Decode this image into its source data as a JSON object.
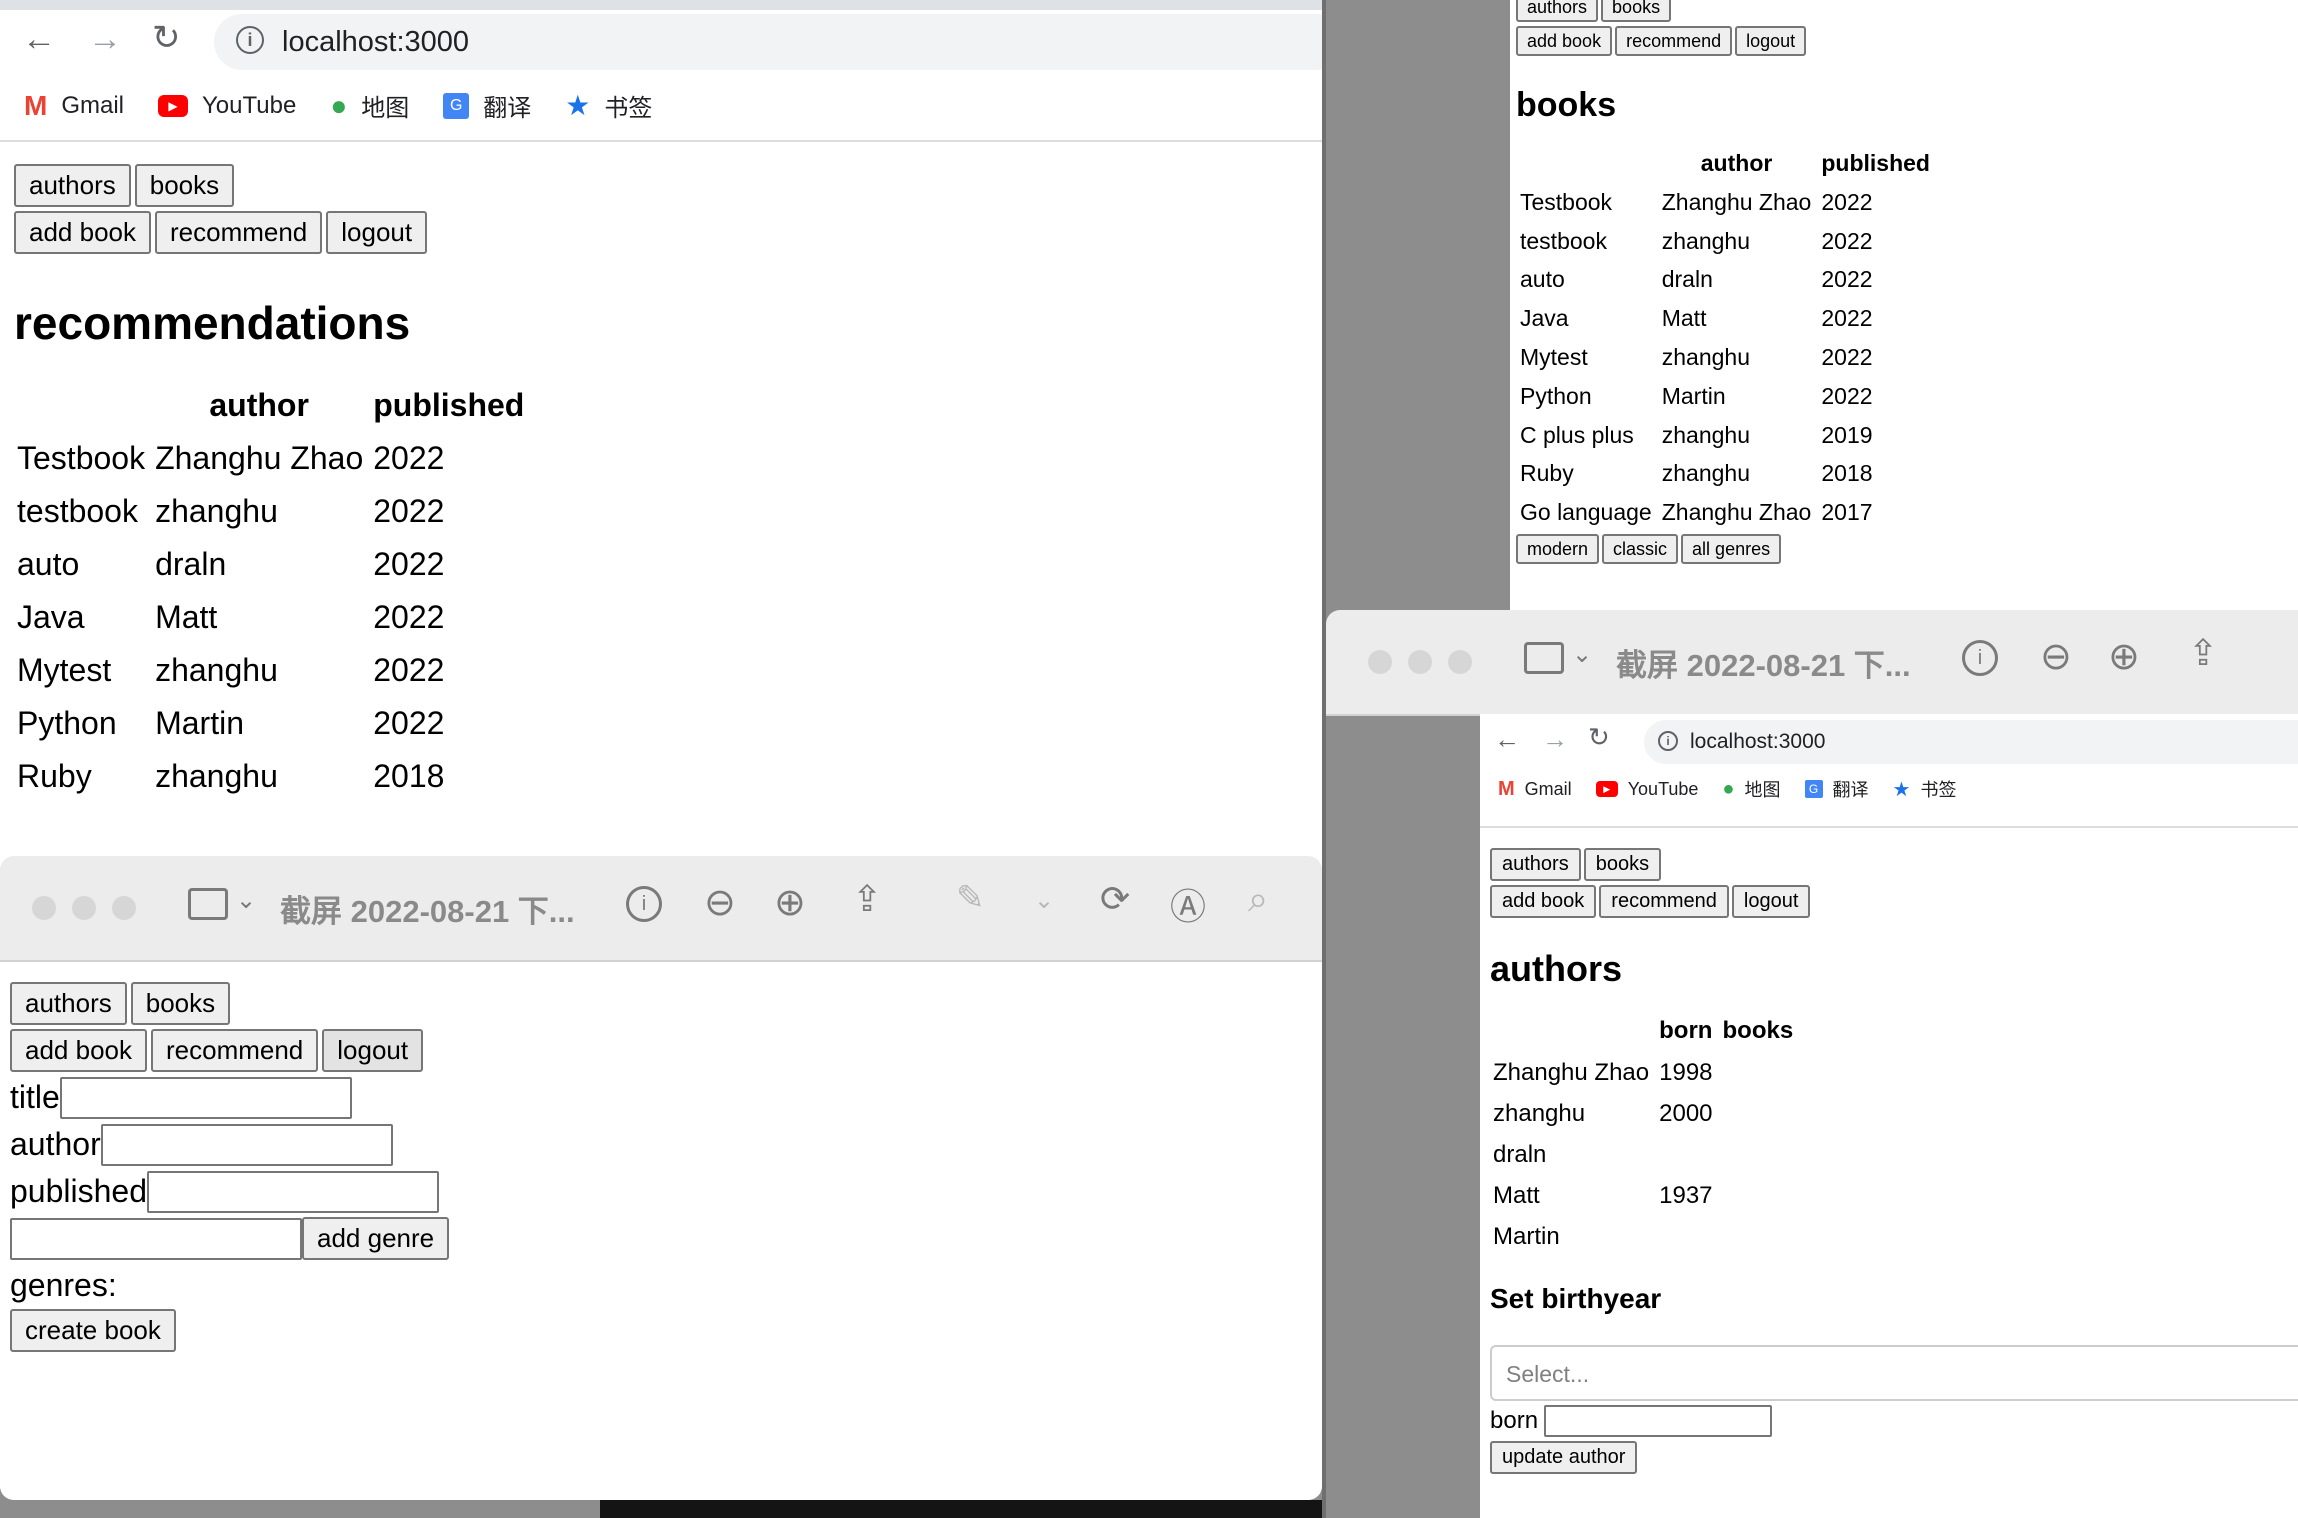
{
  "browser": {
    "url": "localhost:3000",
    "bookmarks": [
      {
        "label": "Gmail",
        "icon": "gmail-icon"
      },
      {
        "label": "YouTube",
        "icon": "youtube-icon"
      },
      {
        "label": "地图",
        "icon": "maps-icon"
      },
      {
        "label": "翻译",
        "icon": "translate-icon"
      },
      {
        "label": "书签",
        "icon": "bookmark-star-icon"
      }
    ]
  },
  "nav": {
    "authors": "authors",
    "books": "books",
    "add_book": "add book",
    "recommend": "recommend",
    "logout": "logout"
  },
  "recommendations": {
    "heading": "recommendations",
    "columns": [
      "",
      "author",
      "published"
    ],
    "rows": [
      [
        "Testbook",
        "Zhanghu Zhao",
        "2022"
      ],
      [
        "testbook",
        "zhanghu",
        "2022"
      ],
      [
        "auto",
        "draln",
        "2022"
      ],
      [
        "Java",
        "Matt",
        "2022"
      ],
      [
        "Mytest",
        "zhanghu",
        "2022"
      ],
      [
        "Python",
        "Martin",
        "2022"
      ],
      [
        "Ruby",
        "zhanghu",
        "2018"
      ]
    ]
  },
  "viewer": {
    "title": "截屏 2022-08-21 下..."
  },
  "add_book_form": {
    "title_label": "title",
    "author_label": "author",
    "published_label": "published",
    "add_genre_button": "add genre",
    "genres_label": "genres:",
    "create_button": "create book"
  },
  "books_page": {
    "heading": "books",
    "columns": [
      "",
      "author",
      "published"
    ],
    "rows": [
      [
        "Testbook",
        "Zhanghu Zhao",
        "2022"
      ],
      [
        "testbook",
        "zhanghu",
        "2022"
      ],
      [
        "auto",
        "draln",
        "2022"
      ],
      [
        "Java",
        "Matt",
        "2022"
      ],
      [
        "Mytest",
        "zhanghu",
        "2022"
      ],
      [
        "Python",
        "Martin",
        "2022"
      ],
      [
        "C plus plus",
        "zhanghu",
        "2019"
      ],
      [
        "Ruby",
        "zhanghu",
        "2018"
      ],
      [
        "Go language",
        "Zhanghu Zhao",
        "2017"
      ]
    ],
    "genre_buttons": [
      "modern",
      "classic",
      "all genres"
    ]
  },
  "authors_page": {
    "heading": "authors",
    "columns": [
      "",
      "born",
      "books"
    ],
    "rows": [
      [
        "Zhanghu Zhao",
        "1998",
        ""
      ],
      [
        "zhanghu",
        "2000",
        ""
      ],
      [
        "draln",
        "",
        ""
      ],
      [
        "Matt",
        "1937",
        ""
      ],
      [
        "Martin",
        "",
        ""
      ]
    ],
    "set_birthyear_heading": "Set birthyear",
    "select_placeholder": "Select...",
    "born_label": "born",
    "update_button": "update author"
  }
}
